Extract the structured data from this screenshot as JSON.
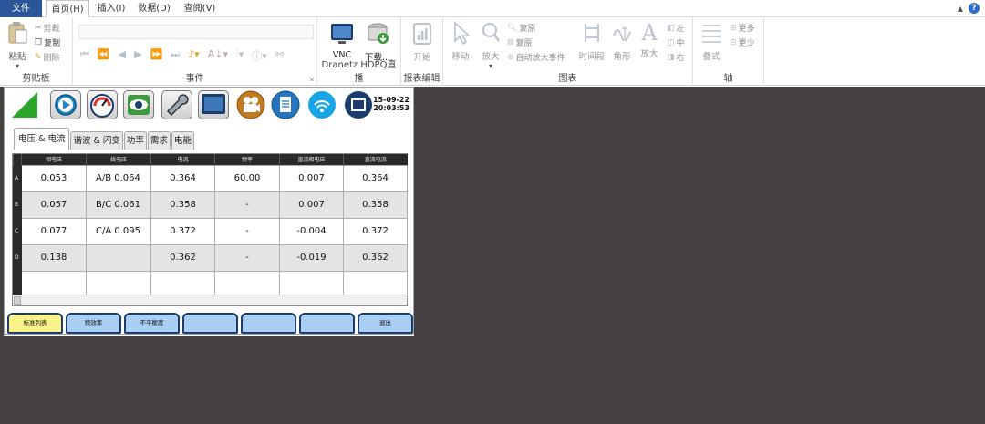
{
  "menu": {
    "file": "文件",
    "tabs": [
      "首页(H)",
      "插入(I)",
      "数据(D)",
      "查阅(V)"
    ]
  },
  "ribbon": {
    "clipboard": {
      "label": "剪贴板",
      "paste": "粘贴",
      "cut": "剪裁",
      "copy": "复制",
      "delete": "删除"
    },
    "events": {
      "label": "事件"
    },
    "dranetz": {
      "label": "Dranetz HDPQ直播",
      "vnc": "VNC",
      "download": "下载..."
    },
    "report": {
      "label": "报表编辑",
      "start": "开始"
    },
    "chart": {
      "label": "图表",
      "move": "移动",
      "zoom": "放大",
      "restore1": "复原",
      "restore2": "复原",
      "auto_zoom": "自动放大事件",
      "time_segment": "时间段",
      "angle": "角形",
      "enlarge": "放大"
    },
    "axis": {
      "label": "轴",
      "stack": "叠式",
      "left": "左",
      "center": "中",
      "right": "右",
      "more": "更多",
      "less": "更少"
    }
  },
  "panel": {
    "date": "15-09-22",
    "time": "20:03:53",
    "tabs": [
      "电压 & 电流",
      "谐波 & 闪变",
      "功率",
      "需求",
      "电能"
    ],
    "table": {
      "headers": [
        "相电压",
        "线电压",
        "电流",
        "频率",
        "直流相电压",
        "直流电流"
      ],
      "rows": [
        {
          "label": "A",
          "cells": [
            "0.053",
            "A/B 0.064",
            "0.364",
            "60.00",
            "0.007",
            "0.364"
          ]
        },
        {
          "label": "B",
          "cells": [
            "0.057",
            "B/C 0.061",
            "0.358",
            "-",
            "0.007",
            "0.358"
          ]
        },
        {
          "label": "C",
          "cells": [
            "0.077",
            "C/A 0.095",
            "0.372",
            "-",
            "-0.004",
            "0.372"
          ]
        },
        {
          "label": "D",
          "cells": [
            "0.138",
            "",
            "0.362",
            "-",
            "-0.019",
            "0.362"
          ]
        },
        {
          "label": "",
          "cells": [
            "",
            "",
            "",
            "",
            "",
            ""
          ]
        }
      ]
    },
    "bottom_buttons": [
      "标准列表",
      "频效率",
      "不平衡度",
      "",
      "",
      "",
      "退出"
    ]
  },
  "colors": {
    "file_tab": "#2b579a",
    "dark_background": "#454141",
    "button_blue": "#a9cff4",
    "button_yellow": "#fbf38a"
  }
}
